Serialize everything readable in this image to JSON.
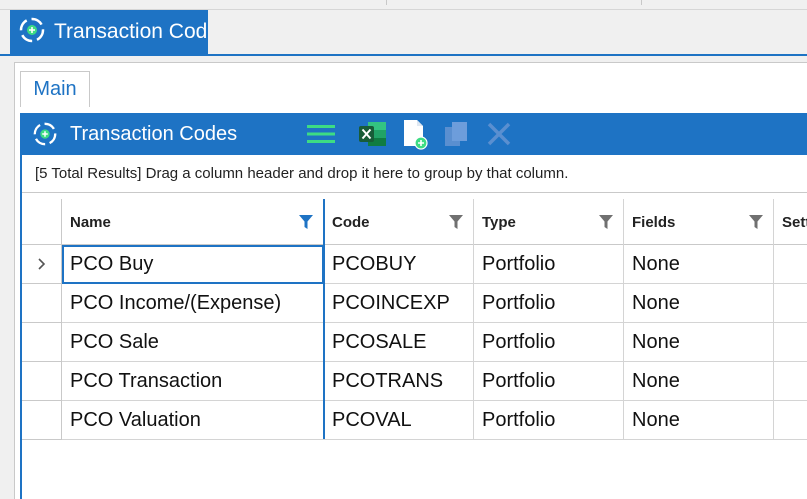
{
  "window": {
    "outer_tab_title": "Transaction Code",
    "inner_tab_label": "Main"
  },
  "panel": {
    "title": "Transaction Codes",
    "toolbar": {
      "menu_icon": "hamburger-menu-icon",
      "excel_icon": "excel-export-icon",
      "new_icon": "new-document-icon",
      "copy_icon": "copy-icon",
      "delete_icon": "delete-x-icon"
    },
    "group_hint": "[5 Total Results] Drag a column header and drop it here to group by that column."
  },
  "grid": {
    "columns": [
      {
        "label": "Name",
        "filter_active": true
      },
      {
        "label": "Code",
        "filter_active": false
      },
      {
        "label": "Type",
        "filter_active": false
      },
      {
        "label": "Fields",
        "filter_active": false
      },
      {
        "label": "Sett",
        "filter_active": false
      }
    ],
    "rows": [
      {
        "name": "PCO Buy",
        "code": "PCOBUY",
        "type": "Portfolio",
        "fields": "None",
        "current": true
      },
      {
        "name": "PCO Income/(Expense)",
        "code": "PCOINCEXP",
        "type": "Portfolio",
        "fields": "None",
        "current": false
      },
      {
        "name": "PCO Sale",
        "code": "PCOSALE",
        "type": "Portfolio",
        "fields": "None",
        "current": false
      },
      {
        "name": "PCO Transaction",
        "code": "PCOTRANS",
        "type": "Portfolio",
        "fields": "None",
        "current": false
      },
      {
        "name": "PCO Valuation",
        "code": "PCOVAL",
        "type": "Portfolio",
        "fields": "None",
        "current": false
      }
    ]
  },
  "colors": {
    "accent": "#1e73c4",
    "filter_active": "#1e73c4",
    "filter_inactive": "#707070",
    "menu_icon": "#3ddc84",
    "excel": "#1d7a45"
  }
}
